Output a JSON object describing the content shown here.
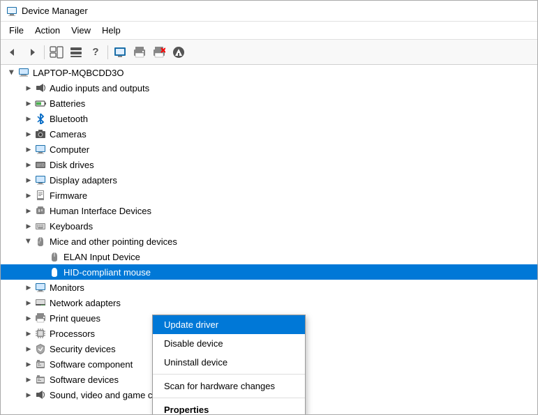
{
  "window": {
    "title": "Device Manager",
    "title_icon": "🖥"
  },
  "menu": {
    "items": [
      {
        "label": "File"
      },
      {
        "label": "Action"
      },
      {
        "label": "View"
      },
      {
        "label": "Help"
      }
    ]
  },
  "toolbar": {
    "buttons": [
      {
        "icon": "◀",
        "name": "back",
        "disabled": false
      },
      {
        "icon": "▶",
        "name": "forward",
        "disabled": false
      },
      {
        "icon": "⊞",
        "name": "show-hide",
        "disabled": false
      },
      {
        "icon": "▤",
        "name": "properties",
        "disabled": false
      },
      {
        "icon": "?",
        "name": "help",
        "disabled": false
      },
      {
        "sep": true
      },
      {
        "icon": "🖥",
        "name": "view-computer",
        "disabled": false
      },
      {
        "icon": "🖨",
        "name": "print",
        "disabled": false
      },
      {
        "icon": "✖",
        "name": "remove",
        "disabled": false,
        "red": true
      },
      {
        "icon": "⬇",
        "name": "update",
        "disabled": false
      }
    ]
  },
  "tree": {
    "root": "LAPTOP-MQBCDD3O",
    "items": [
      {
        "label": "LAPTOP-MQBCDD3O",
        "level": 1,
        "chevron": "open",
        "icon": "💻",
        "iconClass": "icon-computer"
      },
      {
        "label": "Audio inputs and outputs",
        "level": 2,
        "chevron": "close",
        "icon": "🔊",
        "iconClass": "icon-audio"
      },
      {
        "label": "Batteries",
        "level": 2,
        "chevron": "close",
        "icon": "🔋",
        "iconClass": "icon-bat"
      },
      {
        "label": "Bluetooth",
        "level": 2,
        "chevron": "close",
        "icon": "⦿",
        "iconClass": "icon-bluetooth"
      },
      {
        "label": "Cameras",
        "level": 2,
        "chevron": "close",
        "icon": "📷",
        "iconClass": "icon-cam"
      },
      {
        "label": "Computer",
        "level": 2,
        "chevron": "close",
        "icon": "🖥",
        "iconClass": "icon-computer"
      },
      {
        "label": "Disk drives",
        "level": 2,
        "chevron": "close",
        "icon": "💾",
        "iconClass": "icon-disk"
      },
      {
        "label": "Display adapters",
        "level": 2,
        "chevron": "close",
        "icon": "🖥",
        "iconClass": "icon-display"
      },
      {
        "label": "Firmware",
        "level": 2,
        "chevron": "close",
        "icon": "📄",
        "iconClass": "icon-firmware"
      },
      {
        "label": "Human Interface Devices",
        "level": 2,
        "chevron": "close",
        "icon": "⌨",
        "iconClass": "icon-hid"
      },
      {
        "label": "Keyboards",
        "level": 2,
        "chevron": "close",
        "icon": "⌨",
        "iconClass": "icon-keyboard"
      },
      {
        "label": "Mice and other pointing devices",
        "level": 2,
        "chevron": "open",
        "icon": "🖱",
        "iconClass": "icon-mice"
      },
      {
        "label": "ELAN Input Device",
        "level": 3,
        "chevron": "none",
        "icon": "🖱",
        "iconClass": "icon-mice"
      },
      {
        "label": "HID-compliant mouse",
        "level": 3,
        "chevron": "none",
        "icon": "🖱",
        "iconClass": "icon-mice",
        "selected": true
      },
      {
        "label": "Monitors",
        "level": 2,
        "chevron": "close",
        "icon": "🖥",
        "iconClass": "icon-monitor"
      },
      {
        "label": "Network adapters",
        "level": 2,
        "chevron": "close",
        "icon": "🌐",
        "iconClass": "icon-network"
      },
      {
        "label": "Print queues",
        "level": 2,
        "chevron": "close",
        "icon": "🖨",
        "iconClass": "icon-print"
      },
      {
        "label": "Processors",
        "level": 2,
        "chevron": "close",
        "icon": "⚙",
        "iconClass": "icon-proc"
      },
      {
        "label": "Security devices",
        "level": 2,
        "chevron": "close",
        "icon": "🔒",
        "iconClass": "icon-sec"
      },
      {
        "label": "Software component",
        "level": 2,
        "chevron": "close",
        "icon": "📦",
        "iconClass": "icon-soft"
      },
      {
        "label": "Software devices",
        "level": 2,
        "chevron": "close",
        "icon": "📦",
        "iconClass": "icon-soft"
      },
      {
        "label": "Sound, video and game controllers",
        "level": 2,
        "chevron": "close",
        "icon": "🎵",
        "iconClass": "icon-sound"
      }
    ]
  },
  "context_menu": {
    "items": [
      {
        "label": "Update driver",
        "highlighted": true
      },
      {
        "label": "Disable device"
      },
      {
        "label": "Uninstall device"
      },
      {
        "sep": true
      },
      {
        "label": "Scan for hardware changes"
      },
      {
        "sep": true
      },
      {
        "label": "Properties",
        "bold": true
      }
    ]
  },
  "icons": {
    "bluetooth_char": "⦿",
    "chevron_right": "▶",
    "chevron_down": "▼"
  }
}
